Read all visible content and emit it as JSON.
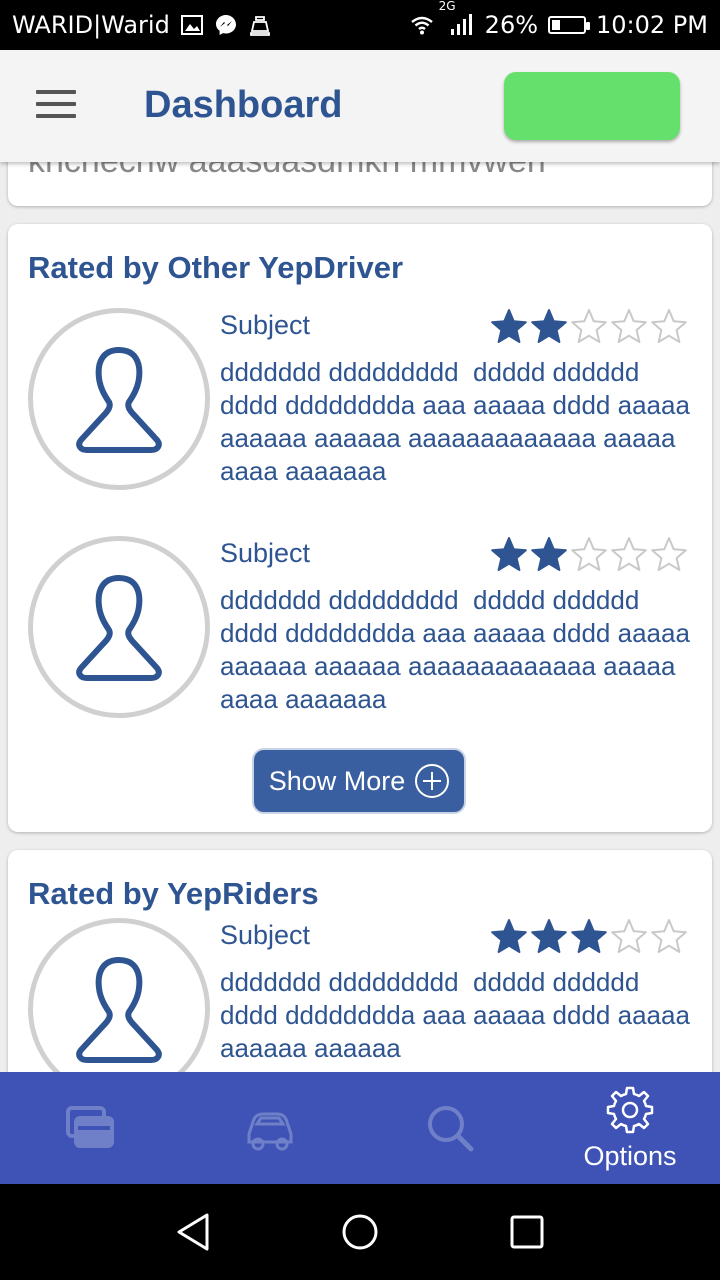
{
  "status_bar": {
    "carrier": "WARID|Warid",
    "network": "2G",
    "battery": "26%",
    "battery_level": 0.26,
    "time": "10:02 PM",
    "icons": [
      "gallery-icon",
      "messenger-icon",
      "notification-icon",
      "wifi-icon",
      "signal-icon",
      "battery-icon"
    ]
  },
  "app_bar": {
    "title": "Dashboard",
    "menu_icon": "hamburger-icon",
    "action_color": "#66e06d"
  },
  "partial_card": {
    "text": "knchechw aaasdasdmkn mmvwen"
  },
  "sections": [
    {
      "title": "Rated by Other YepDriver",
      "reviews": [
        {
          "subject": "Subject",
          "rating": 2,
          "max_rating": 5,
          "text": "ddddddd ddddddddd  ddddd dddddd dddd dddddddda aaa aaaaa dddd aaaaa aaaaaa aaaaaa aaaaaaaaaaaaa aaaaa aaaa aaaaaaa"
        },
        {
          "subject": "Subject",
          "rating": 2,
          "max_rating": 5,
          "text": "ddddddd ddddddddd  ddddd dddddd dddd dddddddda aaa aaaaa dddd aaaaa aaaaaa aaaaaa aaaaaaaaaaaaa aaaaa aaaa aaaaaaa"
        }
      ],
      "show_more_label": "Show More"
    },
    {
      "title": "Rated by YepRiders",
      "reviews": [
        {
          "subject": "Subject",
          "rating": 3,
          "max_rating": 5,
          "text": "ddddddd ddddddddd  ddddd dddddd dddd dddddddda aaa aaaaa dddd aaaaa aaaaaa aaaaaa"
        }
      ]
    }
  ],
  "tab_bar": {
    "tabs": [
      {
        "icon": "cards-icon",
        "label": ""
      },
      {
        "icon": "car-icon",
        "label": ""
      },
      {
        "icon": "search-icon",
        "label": ""
      },
      {
        "icon": "gear-icon",
        "label": "Options"
      }
    ],
    "active_index": 3,
    "background": "#3e53b5"
  },
  "nav_bar": {
    "icons": [
      "back-icon",
      "home-icon",
      "recents-icon"
    ]
  },
  "colors": {
    "primary_text": "#2e5591",
    "star_filled": "#2e5591",
    "star_empty": "#c9c9c9"
  }
}
